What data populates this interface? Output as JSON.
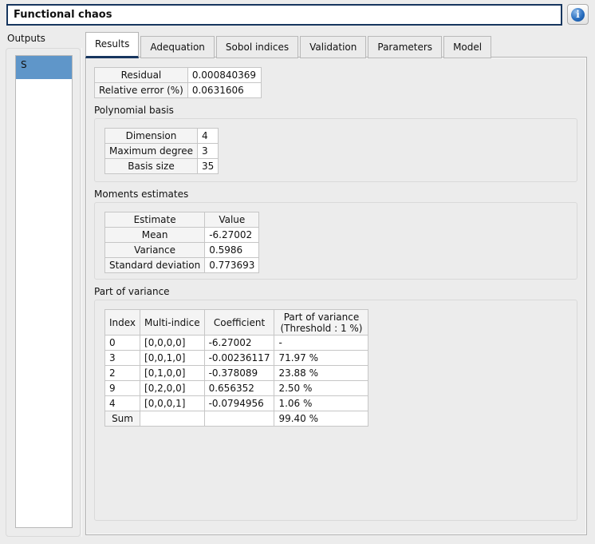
{
  "header": {
    "title": "Functional chaos",
    "info_icon_glyph": "i"
  },
  "outputs_panel": {
    "label": "Outputs",
    "items": [
      {
        "label": "S",
        "selected": true
      }
    ]
  },
  "tab_bar": {
    "active": "Results",
    "tabs": [
      {
        "label": "Results"
      },
      {
        "label": "Adequation"
      },
      {
        "label": "Sobol indices"
      },
      {
        "label": "Validation"
      },
      {
        "label": "Parameters"
      },
      {
        "label": "Model"
      }
    ]
  },
  "results_tab": {
    "error_table": {
      "rows": [
        {
          "label": "Residual",
          "value": "0.000840369"
        },
        {
          "label": "Relative error (%)",
          "value": "0.0631606"
        }
      ]
    },
    "polynomial_basis": {
      "title": "Polynomial basis",
      "rows": [
        {
          "label": "Dimension",
          "value": "4"
        },
        {
          "label": "Maximum degree",
          "value": "3"
        },
        {
          "label": "Basis size",
          "value": "35"
        }
      ]
    },
    "moments_estimates": {
      "title": "Moments estimates",
      "headers": [
        "Estimate",
        "Value"
      ],
      "rows": [
        {
          "label": "Mean",
          "value": "-6.27002"
        },
        {
          "label": "Variance",
          "value": "0.5986"
        },
        {
          "label": "Standard deviation",
          "value": "0.773693"
        }
      ]
    },
    "part_of_variance": {
      "title": "Part of variance",
      "headers": [
        "Index",
        "Multi-indice",
        "Coefficient",
        "Part of variance\n(Threshold : 1 %)"
      ],
      "rows": [
        {
          "index": "0",
          "multi_indice": "[0,0,0,0]",
          "coefficient": "-6.27002",
          "part": "-"
        },
        {
          "index": "3",
          "multi_indice": "[0,0,1,0]",
          "coefficient": "-0.00236117",
          "part": "71.97 %"
        },
        {
          "index": "2",
          "multi_indice": "[0,1,0,0]",
          "coefficient": "-0.378089",
          "part": "23.88 %"
        },
        {
          "index": "9",
          "multi_indice": "[0,2,0,0]",
          "coefficient": "0.656352",
          "part": "2.50 %"
        },
        {
          "index": "4",
          "multi_indice": "[0,0,0,1]",
          "coefficient": "-0.0794956",
          "part": "1.06 %"
        }
      ],
      "sum_row": {
        "label": "Sum",
        "part": "99.40 %"
      }
    }
  },
  "colors": {
    "accent_navy": "#17365f",
    "selection_blue": "#5f96c9",
    "info_blue": "#1565b0",
    "window_bg": "#ececec"
  }
}
